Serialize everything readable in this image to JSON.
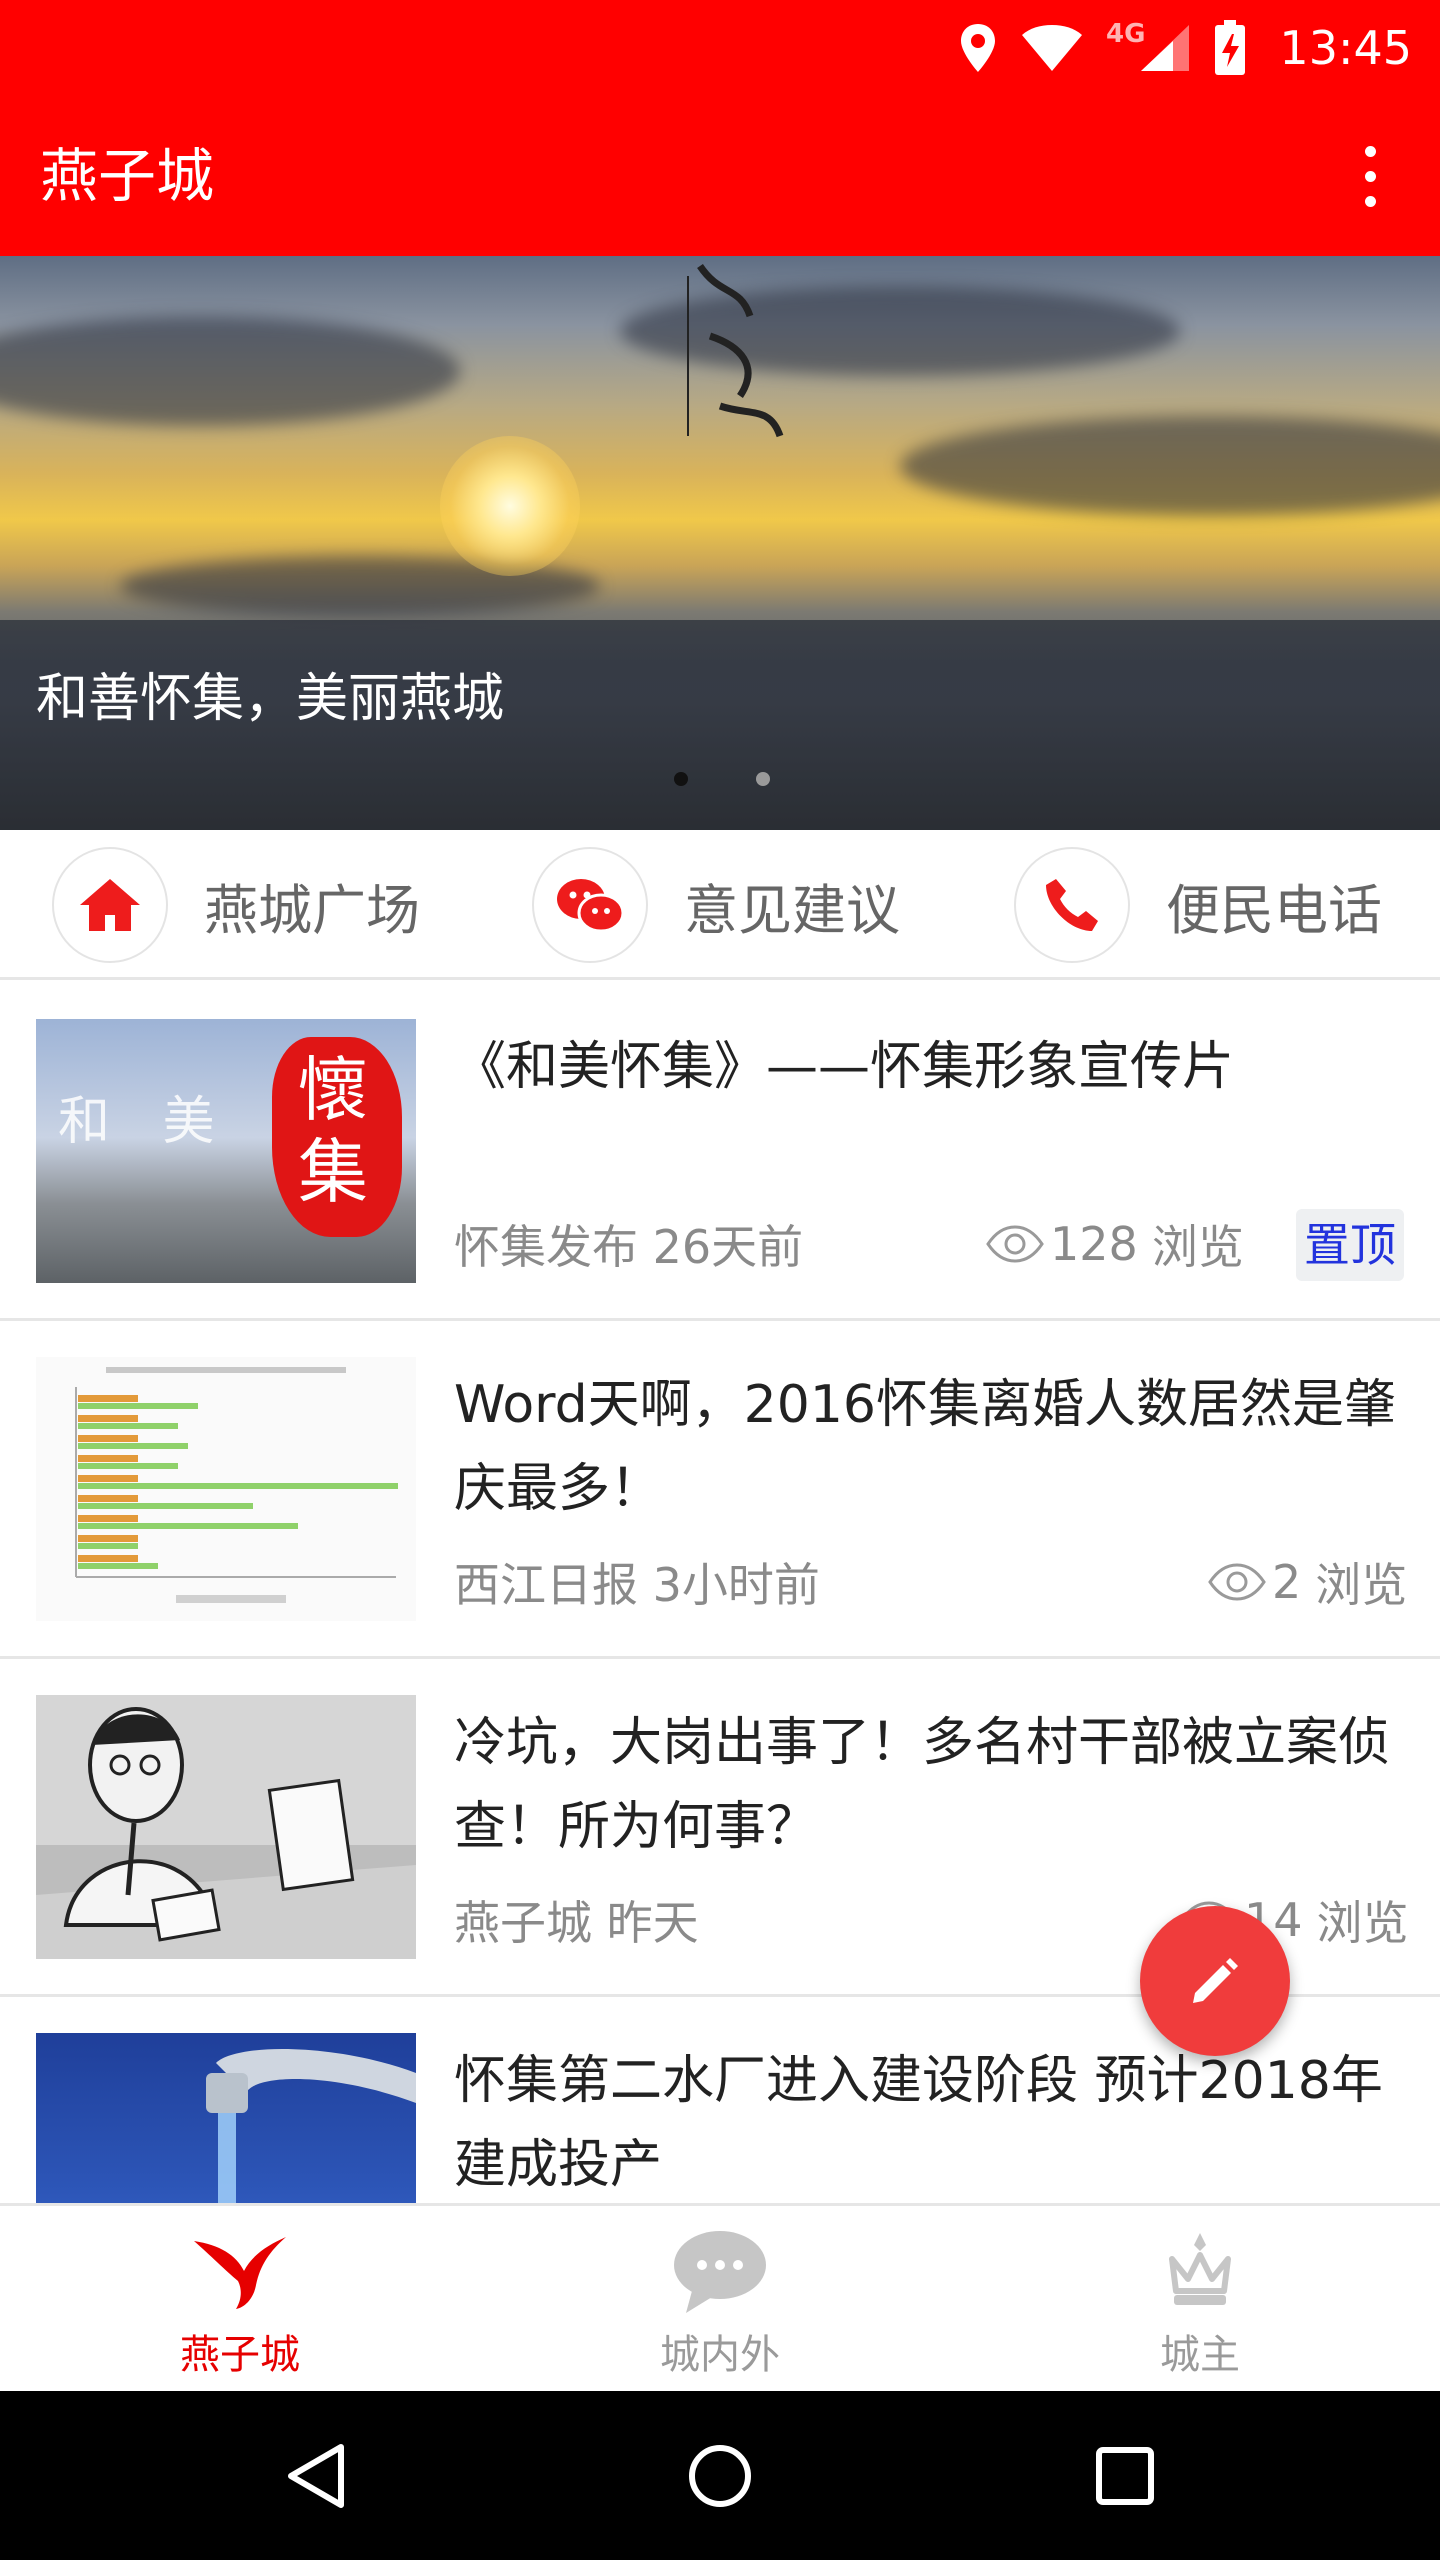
{
  "status_bar": {
    "time": "13:45",
    "network": "4G",
    "icons": [
      "location-icon",
      "wifi-icon",
      "signal-icon",
      "battery-charging-icon"
    ]
  },
  "app_bar": {
    "title": "燕子城",
    "menu_icon": "overflow-menu-icon"
  },
  "banner": {
    "caption": "和善怀集，美丽燕城",
    "page_count": 2,
    "active_index": 0
  },
  "quick_links": [
    {
      "label": "燕城广场",
      "icon": "home-icon"
    },
    {
      "label": "意见建议",
      "icon": "wechat-icon"
    },
    {
      "label": "便民电话",
      "icon": "phone-icon"
    }
  ],
  "articles": [
    {
      "title": "《和美怀集》——怀集形象宣传片",
      "source": "怀集发布",
      "time": "26天前",
      "views": "128",
      "views_suffix": "浏览",
      "pinned_label": "置顶",
      "thumb_text": "和 美",
      "thumb_brush": "懷集"
    },
    {
      "title": "Word天啊，2016怀集离婚人数居然是肇庆最多！",
      "source": "西江日报",
      "time": "3小时前",
      "views": "2",
      "views_suffix": "浏览"
    },
    {
      "title": "冷坑，大岗出事了！多名村干部被立案侦查！所为何事？",
      "source": "燕子城",
      "time": "昨天",
      "views": "14",
      "views_suffix": "浏览"
    },
    {
      "title": "怀集第二水厂进入建设阶段 预计2018年建成投产"
    }
  ],
  "fab_icon": "edit-icon",
  "bottom_nav": [
    {
      "label": "燕子城",
      "icon": "swallow-icon",
      "active": true
    },
    {
      "label": "城内外",
      "icon": "chat-bubble-icon",
      "active": false
    },
    {
      "label": "城主",
      "icon": "crown-icon",
      "active": false
    }
  ],
  "colors": {
    "primary": "#ff0000",
    "nav_active": "#e60000",
    "nav_inactive": "#9a9a9a",
    "pin_text": "#2233dd",
    "fab": "#f03c3c"
  }
}
